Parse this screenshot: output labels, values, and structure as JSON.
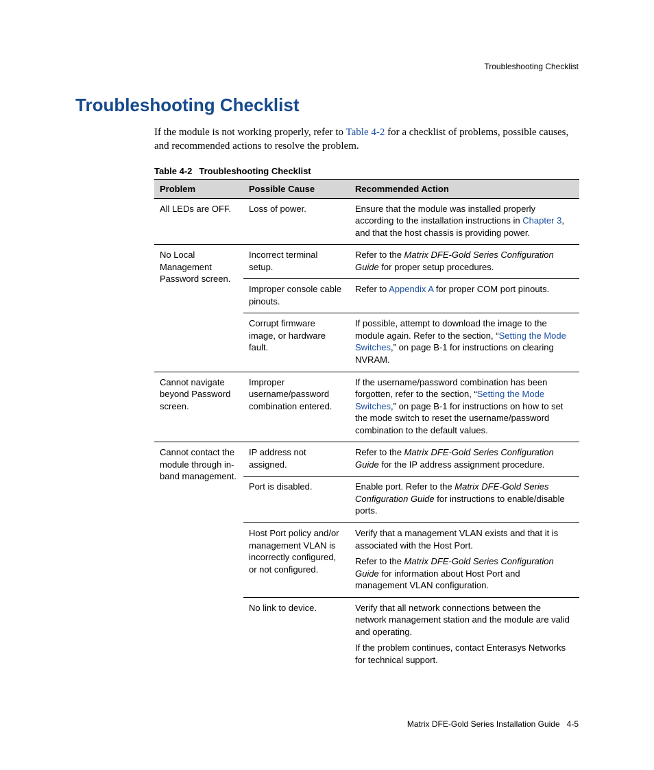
{
  "runningHead": "Troubleshooting Checklist",
  "sectionTitle": "Troubleshooting Checklist",
  "intro": {
    "pre": "If the module is not working properly, refer to ",
    "link": "Table 4-2",
    "post": " for a checklist of problems, possible causes, and recommended actions to resolve the problem."
  },
  "tableCaption": {
    "num": "Table 4-2",
    "title": "Troubleshooting Checklist"
  },
  "headers": {
    "problem": "Problem",
    "cause": "Possible Cause",
    "action": "Recommended Action"
  },
  "rows": {
    "r1": {
      "problem": "All LEDs are OFF.",
      "cause": "Loss of power.",
      "action": {
        "a": "Ensure that the module was installed properly according to the installation instructions in ",
        "link": "Chapter 3",
        "b": ", and that the host chassis is providing power."
      }
    },
    "r2": {
      "problem": "No Local Management Password screen.",
      "c1": {
        "cause": "Incorrect terminal setup.",
        "action": {
          "a": "Refer to the ",
          "ital": "Matrix DFE-Gold Series Configuration Guide",
          "b": " for proper setup procedures."
        }
      },
      "c2": {
        "cause": "Improper console cable pinouts.",
        "action": {
          "a": "Refer to ",
          "link": "Appendix A",
          "b": " for proper COM port pinouts."
        }
      },
      "c3": {
        "cause": "Corrupt firmware image, or hardware fault.",
        "action": {
          "a": "If possible, attempt to download the image to the module again. Refer to the section, “",
          "link": "Setting the Mode Switches",
          "b": ",” on page B-1 for instructions on clearing NVRAM."
        }
      }
    },
    "r3": {
      "problem": "Cannot navigate beyond Password screen.",
      "cause": "Improper username/password combination entered.",
      "action": {
        "a": "If the username/password combination has been forgotten, refer to the section, “",
        "link": "Setting the Mode Switches",
        "b": ",” on page B-1 for instructions on how to set the mode switch to reset the username/password combination to the default values."
      }
    },
    "r4": {
      "problem": "Cannot contact the module through in-band management.",
      "c1": {
        "cause": "IP address not assigned.",
        "action": {
          "a": "Refer to the ",
          "ital": "Matrix DFE-Gold Series Configuration Guide",
          "b": " for the IP address assignment procedure."
        }
      },
      "c2": {
        "cause": "Port is disabled.",
        "action": {
          "a": "Enable port. Refer to the ",
          "ital": "Matrix DFE-Gold Series Configuration Guide",
          "b": " for instructions to enable/disable ports."
        }
      },
      "c3": {
        "cause": "Host Port policy and/or management VLAN is incorrectly configured, or not configured.",
        "action1": "Verify that a management VLAN exists and that it is associated with the Host Port.",
        "action2": {
          "a": "Refer to the ",
          "ital": "Matrix DFE-Gold Series Configuration Guide",
          "b": " for information about Host Port and management VLAN configuration."
        }
      },
      "c4": {
        "cause": "No link to device.",
        "action1": "Verify that all network connections between the network management station and the module are valid and operating.",
        "action2": "If the problem continues, contact Enterasys Networks for technical support."
      }
    }
  },
  "footer": {
    "book": "Matrix DFE-Gold Series Installation Guide",
    "page": "4-5"
  }
}
